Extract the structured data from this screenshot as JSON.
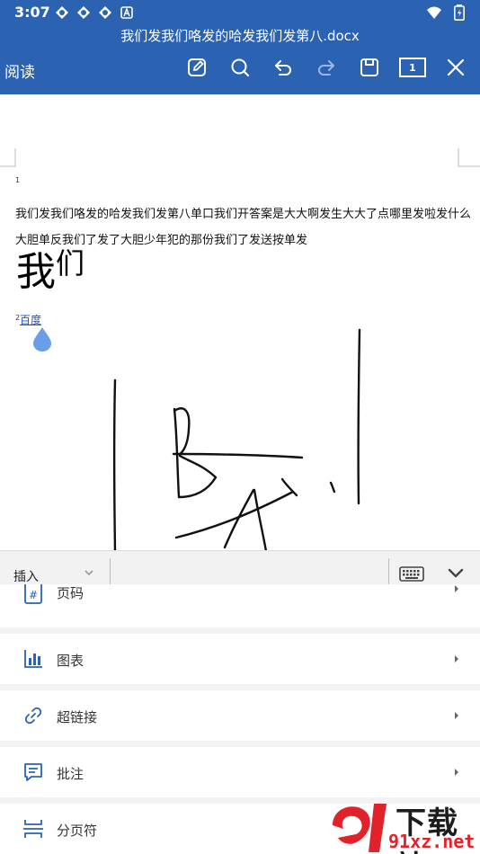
{
  "status_bar": {
    "time": "3:07"
  },
  "header": {
    "document_title": "我们发我们咯发的哈发我们发第八.docx",
    "mode": "阅读",
    "page_count": "1",
    "icons": [
      "edit-icon",
      "search-icon",
      "undo-icon",
      "redo-icon",
      "save-icon",
      "page-count-icon",
      "close-icon"
    ]
  },
  "document": {
    "paragraph_number_1": "1",
    "line_1": "我们发我们咯发的哈发我们发第八单口我们开答案是大大啊发生大大了点哪里发啦发什么",
    "line_2": "大胆单反我们了发了大胆少年犯的那份我们了发送按单发",
    "large_text_main": "我",
    "large_text_small": "们",
    "footnote_number": "2",
    "link_text": "百度"
  },
  "insert_panel": {
    "label": "插入",
    "items": [
      {
        "label": "页码",
        "icon": "page-number-icon"
      },
      {
        "label": "图表",
        "icon": "chart-icon"
      },
      {
        "label": "超链接",
        "icon": "hyperlink-icon"
      },
      {
        "label": "批注",
        "icon": "comment-icon"
      },
      {
        "label": "分页符",
        "icon": "page-break-icon"
      }
    ]
  },
  "watermark": {
    "top": "下载站",
    "bottom": "91xz.net"
  },
  "colors": {
    "header_bg": "#2b63b2",
    "link": "#1a4fd8",
    "cursor_drop": "#6a9ee6",
    "watermark_red": "#e2222b"
  }
}
